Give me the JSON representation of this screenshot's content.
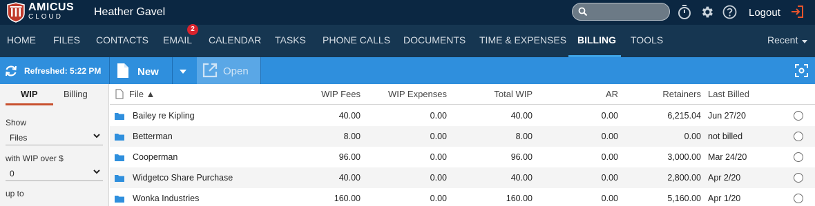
{
  "header": {
    "brand_main": "AMICUS",
    "brand_sub": "CLOUD",
    "user_name": "Heather Gavel",
    "search_placeholder": "",
    "logout_label": "Logout"
  },
  "nav": {
    "items": [
      {
        "label": "HOME"
      },
      {
        "label": "FILES"
      },
      {
        "label": "CONTACTS"
      },
      {
        "label": "EMAIL",
        "badge": "2"
      },
      {
        "label": "CALENDAR"
      },
      {
        "label": "TASKS"
      },
      {
        "label": "PHONE CALLS"
      },
      {
        "label": "DOCUMENTS"
      },
      {
        "label": "TIME & EXPENSES"
      },
      {
        "label": "BILLING",
        "active": true
      },
      {
        "label": "TOOLS"
      }
    ],
    "recent_label": "Recent"
  },
  "toolbar": {
    "refreshed_label": "Refreshed: 5:22 PM",
    "new_label": "New",
    "open_label": "Open"
  },
  "left_panel": {
    "tabs": [
      {
        "label": "WIP",
        "active": true
      },
      {
        "label": "Billing"
      }
    ],
    "show_label": "Show",
    "show_value": "Files",
    "wip_over_label": "with WIP over $",
    "wip_over_value": "0",
    "up_to_label": "up to"
  },
  "table": {
    "columns": [
      "File ▲",
      "WIP Fees",
      "WIP Expenses",
      "Total WIP",
      "AR",
      "Retainers",
      "Last Billed"
    ],
    "rows": [
      {
        "file": "Bailey re Kipling",
        "wip_fees": "40.00",
        "wip_expenses": "0.00",
        "total_wip": "40.00",
        "ar": "0.00",
        "retainers": "6,215.04",
        "last_billed": "Jun 27/20"
      },
      {
        "file": "Betterman",
        "wip_fees": "8.00",
        "wip_expenses": "0.00",
        "total_wip": "8.00",
        "ar": "0.00",
        "retainers": "0.00",
        "last_billed": "not billed"
      },
      {
        "file": "Cooperman",
        "wip_fees": "96.00",
        "wip_expenses": "0.00",
        "total_wip": "96.00",
        "ar": "0.00",
        "retainers": "3,000.00",
        "last_billed": "Mar 24/20"
      },
      {
        "file": "Widgetco Share Purchase",
        "wip_fees": "40.00",
        "wip_expenses": "0.00",
        "total_wip": "40.00",
        "ar": "0.00",
        "retainers": "2,800.00",
        "last_billed": "Apr 2/20"
      },
      {
        "file": "Wonka Industries",
        "wip_fees": "160.00",
        "wip_expenses": "0.00",
        "total_wip": "160.00",
        "ar": "0.00",
        "retainers": "5,160.00",
        "last_billed": "Apr 1/20"
      }
    ]
  },
  "colors": {
    "topbar": "#0b2742",
    "navbar": "#163651",
    "toolbar": "#2f8fdd",
    "active_underline": "#3fa4e6",
    "badge": "#d9232d",
    "tab_underline": "#c8502e",
    "folder": "#2f8fdd",
    "logout_icon": "#e8542c"
  },
  "icons": {
    "logo": "amicus-shield-icon",
    "search": "search-icon",
    "timer": "stopwatch-icon",
    "settings": "gear-icon",
    "help": "help-circle-icon",
    "logout": "logout-arrow-icon",
    "refresh": "refresh-icon",
    "new": "document-icon",
    "open": "open-external-icon",
    "focus": "focus-screen-icon",
    "folder": "folder-icon"
  }
}
